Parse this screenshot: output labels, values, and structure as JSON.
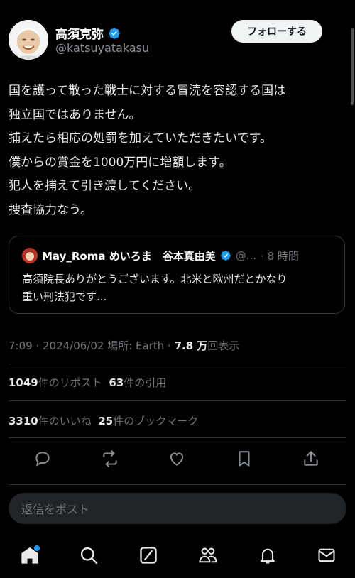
{
  "author": {
    "name": "高須克弥",
    "handle": "@katsuyatakasu",
    "follow_label": "フォローする"
  },
  "tweet": {
    "lines": [
      "国を護って散った戦士に対する冒涜を容認する国は",
      "独立国ではありません。",
      "捕えたら相応の処罰を加えていただきたいです。",
      "僕からの賞金を1000万円に増額します。",
      "犯人を捕えて引き渡してください。",
      "捜査協力なう。"
    ]
  },
  "quote": {
    "name": "May_Roma めいろま　谷本真由美",
    "handle": "@...",
    "time": "· 8 時間",
    "line1": "高須院長ありがとうございます。北米と欧州だとかなり",
    "line2": "重い刑法犯です..."
  },
  "meta": {
    "time": "7:09 · 2024/06/02 ",
    "location": "場所: Earth · ",
    "views": "7.8 万",
    "views_suffix": "回表示"
  },
  "stats": {
    "reposts": "1049",
    "reposts_label": "件のリポスト",
    "quotes": "63",
    "quotes_label": "件の引用",
    "likes": "3310",
    "likes_label": "件のいいね",
    "bookmarks": "25",
    "bookmarks_label": "件のブックマーク"
  },
  "reply": {
    "placeholder": "返信をポスト"
  },
  "colors": {
    "background": "#000000",
    "verified": "#1d9bf0",
    "muted": "#71767b",
    "divider": "#2f3336"
  }
}
